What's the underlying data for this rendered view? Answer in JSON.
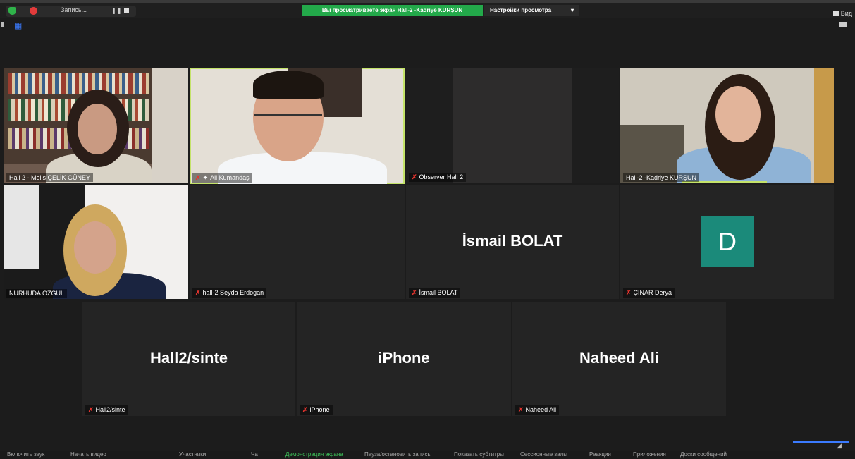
{
  "topbar": {
    "recording_label": "Запись...",
    "viewing_banner": "Вы просматриваете экран Hall-2 -Kadriye KURŞUN",
    "view_options": "Настройки просмотра",
    "view_label": "Вид"
  },
  "tiles": [
    {
      "name": "Hall 2 - Melis ÇELİK GÜNEY",
      "muted": false
    },
    {
      "name": "Ali Kumandaş",
      "muted": true,
      "pinned": true
    },
    {
      "name": "Observer Hall 2",
      "muted": true
    },
    {
      "name": "Hall-2 -Kadriye KURŞUN",
      "muted": false
    },
    {
      "name": "NURHUDA ÖZGÜL",
      "muted": false
    },
    {
      "name": "hall-2 Seyda Erdogan",
      "muted": true
    },
    {
      "name": "İsmail BOLAT",
      "display": "İsmail BOLAT",
      "muted": true
    },
    {
      "name": "ÇINAR Derya",
      "avatar": "D",
      "muted": true
    },
    {
      "name": "Hall2/sinte",
      "display": "Hall2/sinte",
      "muted": true
    },
    {
      "name": "iPhone",
      "display": "iPhone",
      "muted": true
    },
    {
      "name": "Naheed Ali",
      "display": "Naheed Ali",
      "muted": true
    }
  ],
  "toolbar": {
    "unmute": "Включить звук",
    "start_video": "Начать видео",
    "participants": "Участники",
    "chat": "Чат",
    "share_screen": "Демонстрация экрана",
    "pause_record": "Пауза/остановить запись",
    "captions": "Показать субтитры",
    "breakout": "Сессионные залы",
    "reactions": "Реакции",
    "apps": "Приложения",
    "whiteboards": "Доски сообщений"
  },
  "colors": {
    "accent_green": "#23a94a",
    "active_speaker": "#c4e36a",
    "avatar_teal": "#1b8a7a",
    "muted_red": "#e5342e"
  }
}
